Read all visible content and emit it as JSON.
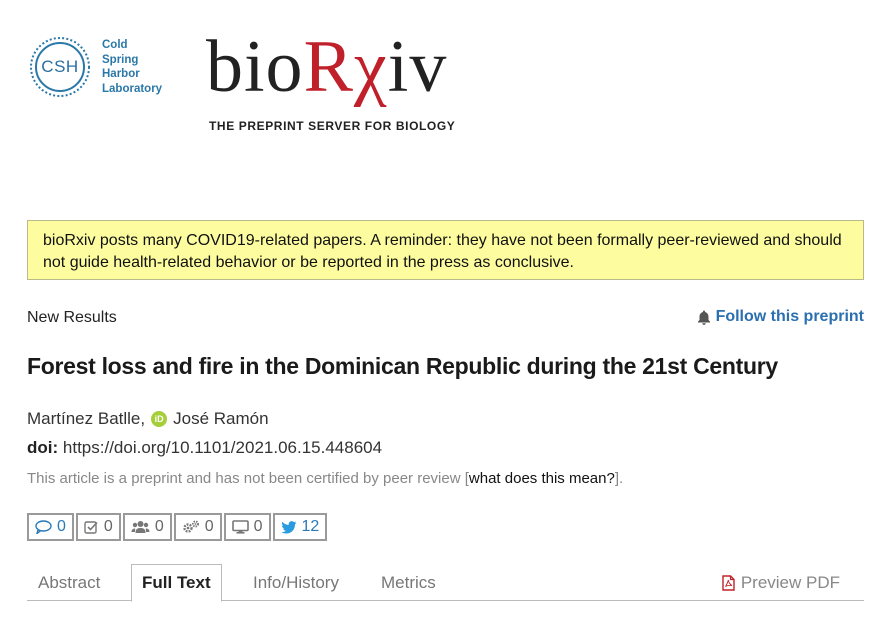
{
  "header": {
    "csh_logo": {
      "label": "CSH",
      "lines": [
        "Cold",
        "Spring",
        "Harbor",
        "Laboratory"
      ]
    },
    "biorxiv_logo": {
      "word_part1": "bio",
      "word_part2": "Rχ",
      "word_part3": "iv",
      "tagline": "THE PREPRINT SERVER FOR BIOLOGY"
    }
  },
  "notice": {
    "text": "bioRxiv posts many COVID19-related papers. A reminder: they have not been formally peer-reviewed and should not guide health-related behavior or be reported in the press as conclusive."
  },
  "article": {
    "type": "New Results",
    "follow_label": "Follow this preprint",
    "title": "Forest loss and fire in the Dominican Republic during the 21st Century",
    "author_last": "Martínez Batlle,",
    "author_first": "José Ramón",
    "doi_label": "doi:",
    "doi_value": "https://doi.org/10.1101/2021.06.15.448604",
    "disclaimer_prefix": "This article is a preprint and has not been certified by peer review [",
    "disclaimer_link": "what does this mean?",
    "disclaimer_suffix": "]."
  },
  "metrics": {
    "comments": "0",
    "reviews": "0",
    "community": "0",
    "automated": "0",
    "media": "0",
    "twitter": "12"
  },
  "tabs": {
    "abstract": "Abstract",
    "full_text": "Full Text",
    "info_history": "Info/History",
    "metrics": "Metrics",
    "preview_pdf": "Preview PDF"
  },
  "colors": {
    "link_blue": "#2a6fb0",
    "notice_bg": "#fdfda0",
    "brand_red": "#c0202a",
    "orcid_green": "#a6ce39"
  }
}
